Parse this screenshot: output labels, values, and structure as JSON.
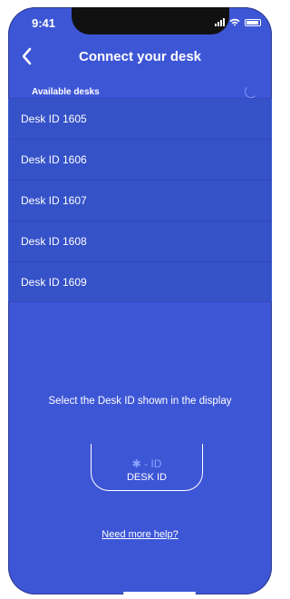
{
  "status_bar": {
    "time": "9:41"
  },
  "header": {
    "back_icon": "chevron-left-icon",
    "title": "Connect your desk"
  },
  "section": {
    "label": "Available desks",
    "loading_icon": "spinner-icon"
  },
  "desks": [
    {
      "label": "Desk ID 1605"
    },
    {
      "label": "Desk ID 1606"
    },
    {
      "label": "Desk ID 1607"
    },
    {
      "label": "Desk ID 1608"
    },
    {
      "label": "Desk ID 1609"
    }
  ],
  "instruction": "Select the Desk ID shown in the display",
  "display_illustration": {
    "bluetooth_label": "✱ - ID",
    "desk_id_label": "DESK ID"
  },
  "help_link": "Need more help?",
  "colors": {
    "background": "#3d56d6",
    "row": "#3552c8",
    "accent_light": "#8ea2ff",
    "text": "#ffffff"
  }
}
